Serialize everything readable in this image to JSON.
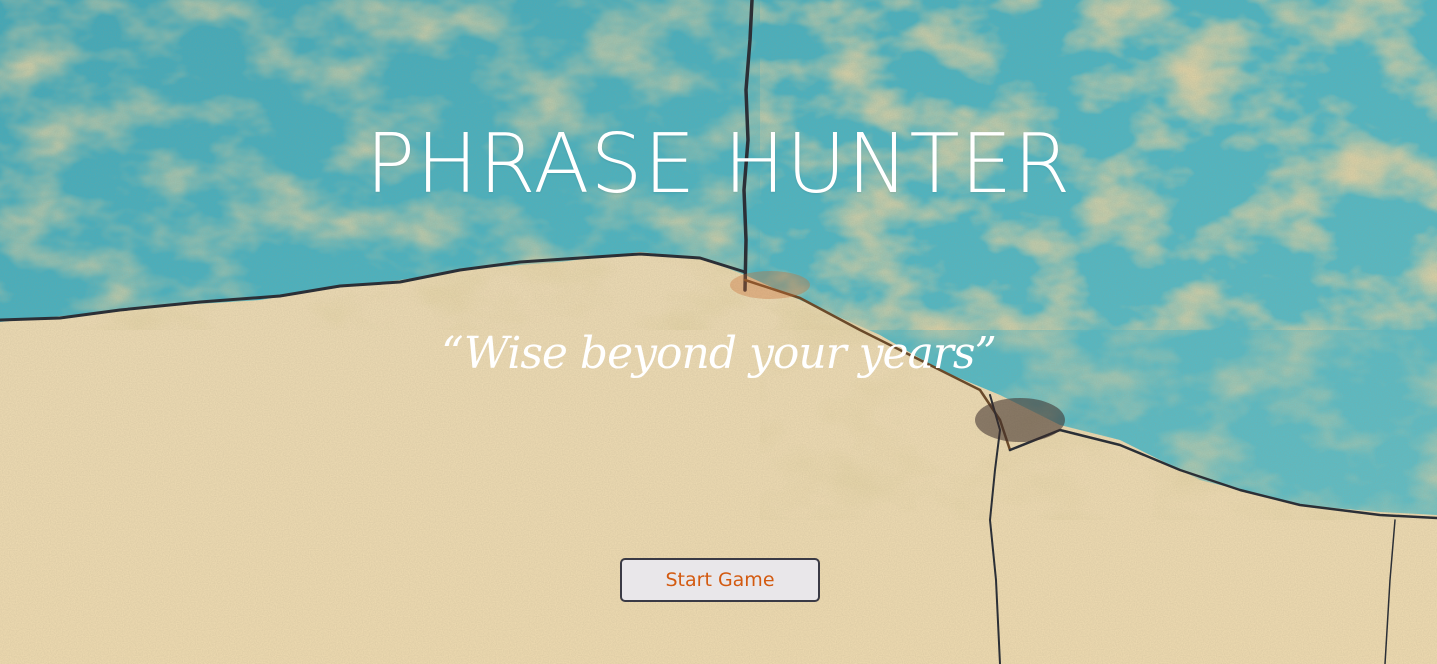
{
  "app": {
    "title": "PHRASE HUNTER",
    "phrase": "“Wise beyond your years”"
  },
  "controls": {
    "start_label": "Start Game"
  },
  "colors": {
    "title_text": "#ffffff",
    "phrase_text": "#ffffff",
    "button_text": "#d35a10",
    "button_bg": "#e9e7ea",
    "button_border": "#3a3a45",
    "wall_teal": "#3fb1c4",
    "wall_concrete": "#eedcb4"
  },
  "icons": {
    "background": "cracked-wall-texture"
  }
}
